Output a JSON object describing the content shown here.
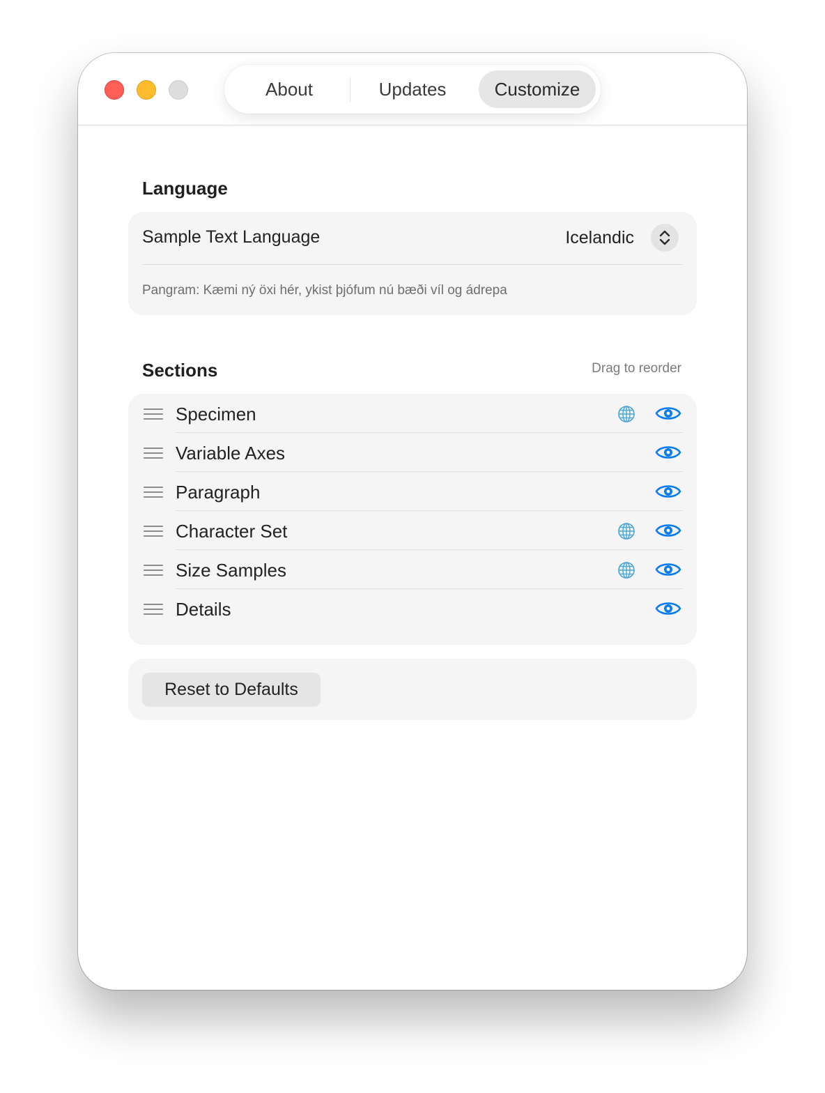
{
  "window": {
    "tabs": [
      {
        "label": "About",
        "selected": false
      },
      {
        "label": "Updates",
        "selected": false
      },
      {
        "label": "Customize",
        "selected": true
      }
    ]
  },
  "language": {
    "heading": "Language",
    "sample_text_label": "Sample Text Language",
    "selected_language": "Icelandic",
    "pangram": "Pangram: Kæmi ný öxi hér, ykist þjófum nú bæði víl og ádrepa"
  },
  "sections": {
    "heading": "Sections",
    "hint": "Drag to reorder",
    "items": [
      {
        "label": "Specimen",
        "language_aware": true,
        "visible": true
      },
      {
        "label": "Variable Axes",
        "language_aware": false,
        "visible": true
      },
      {
        "label": "Paragraph",
        "language_aware": false,
        "visible": true
      },
      {
        "label": "Character Set",
        "language_aware": true,
        "visible": true
      },
      {
        "label": "Size Samples",
        "language_aware": true,
        "visible": true
      },
      {
        "label": "Details",
        "language_aware": false,
        "visible": true
      }
    ]
  },
  "actions": {
    "reset_label": "Reset to Defaults"
  },
  "colors": {
    "accent": "#0a7cf2",
    "globe": "#4aa3d8",
    "close": "#fe5f57",
    "minimize": "#febc2e",
    "zoom_disabled": "#dddddd"
  },
  "icons": {
    "drag": "drag-handle-icon",
    "globe": "globe-icon",
    "visibility": "eye-icon",
    "stepper": "chevron-up-down-icon"
  }
}
